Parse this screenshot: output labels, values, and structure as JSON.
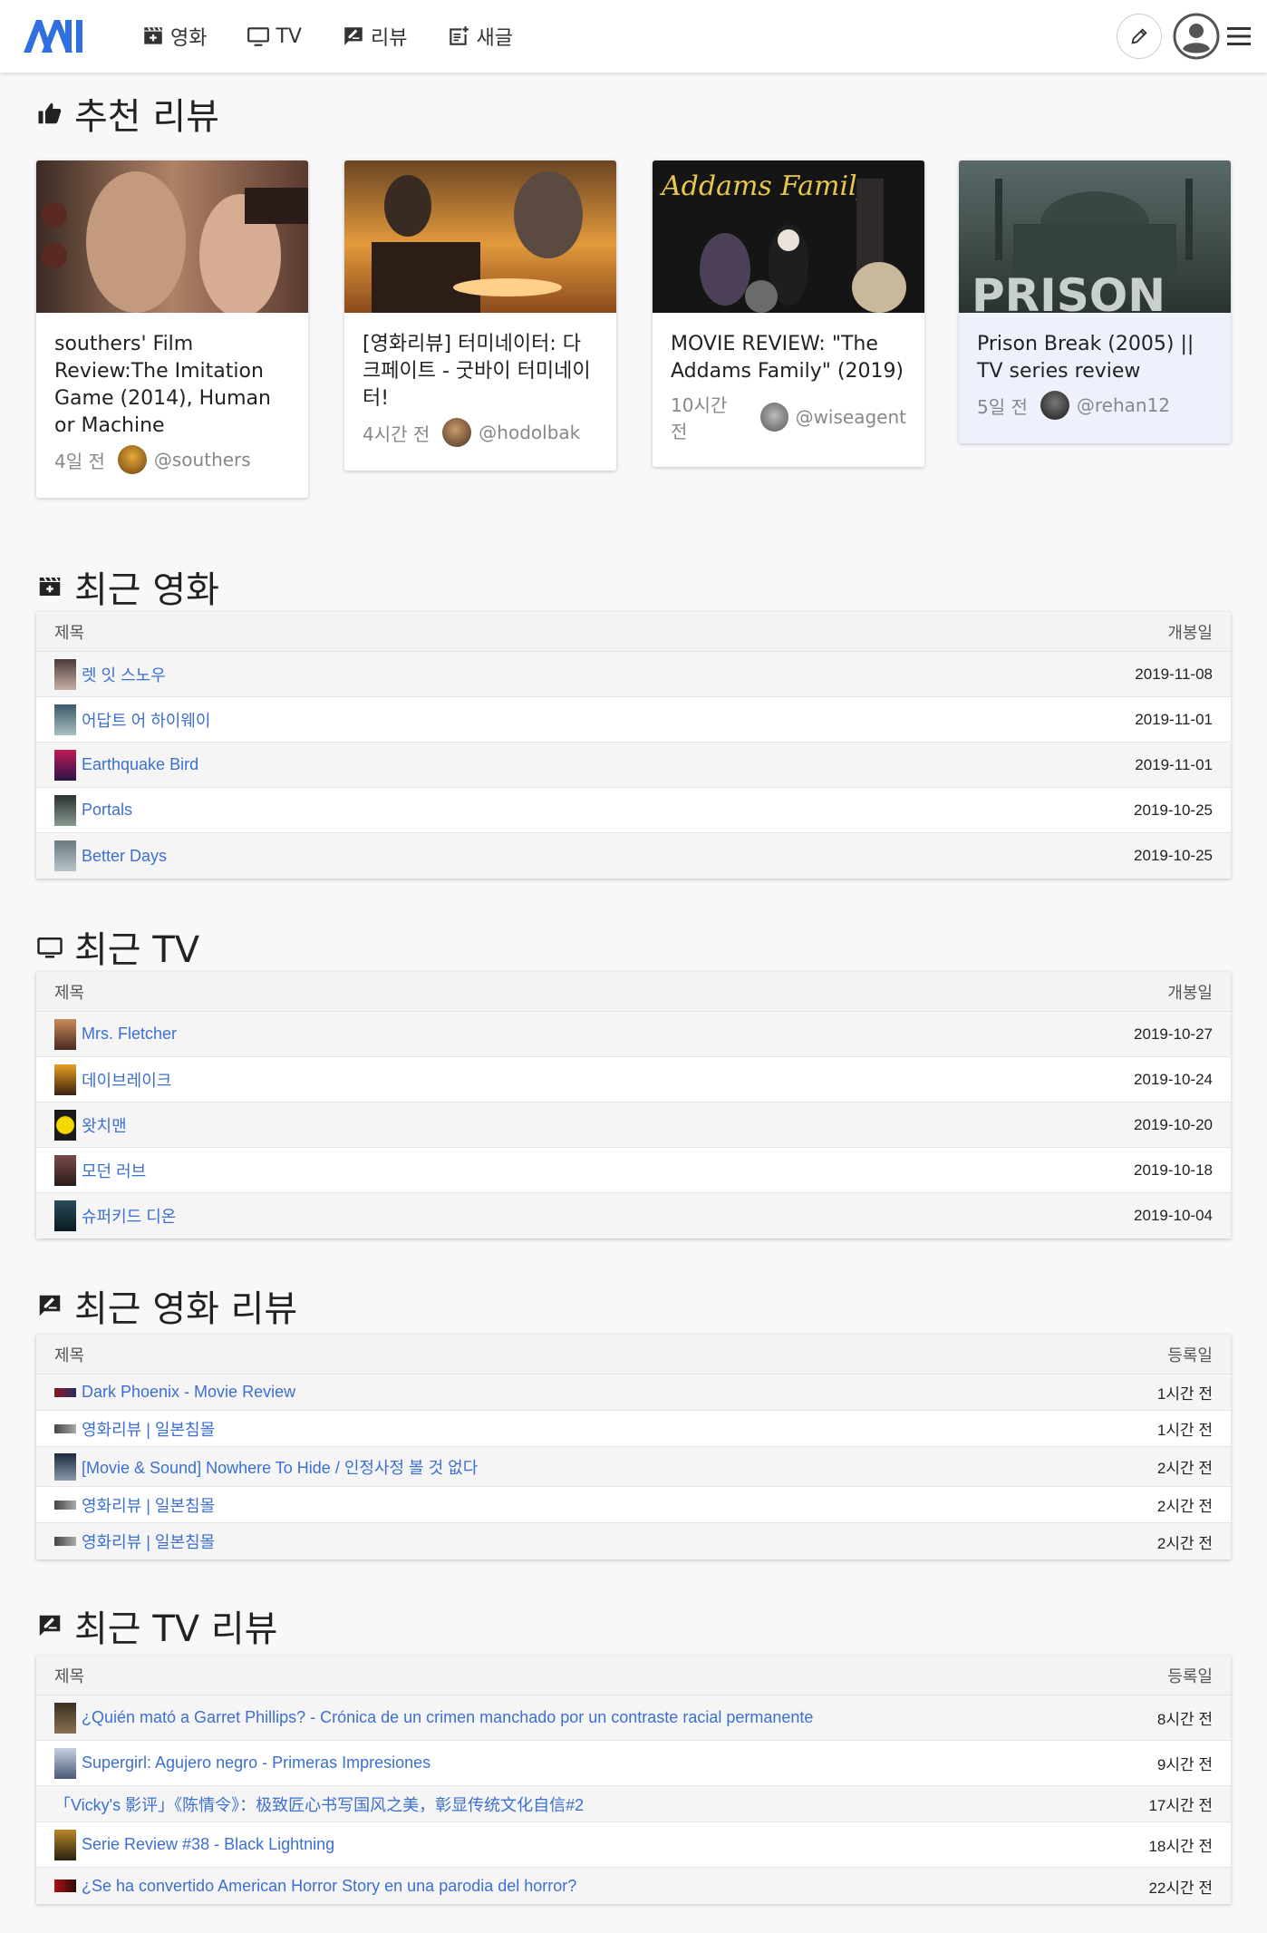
{
  "header": {
    "nav": [
      {
        "label": "영화",
        "icon": "movie-icon"
      },
      {
        "label": "TV",
        "icon": "tv-icon"
      },
      {
        "label": "리뷰",
        "icon": "review-icon"
      },
      {
        "label": "새글",
        "icon": "new-post-icon"
      }
    ]
  },
  "featured": {
    "title": "추천 리뷰",
    "cards": [
      {
        "title": "southers' Film Review:The Imitation Game (2014), Human or Machine",
        "time": "4일 전",
        "author": "@southers"
      },
      {
        "title": "[영화리뷰] 터미네이터: 다크페이트 - 굿바이 터미네이터!",
        "time": "4시간 전",
        "author": "@hodolbak"
      },
      {
        "title": "MOVIE REVIEW: \"The Addams Family\" (2019)",
        "time": "10시간 전",
        "author": "@wiseagent"
      },
      {
        "title": "Prison Break (2005) || TV series review",
        "time": "5일 전",
        "author": "@rehan12"
      }
    ]
  },
  "recent_movies": {
    "title": "최근 영화",
    "col_title": "제목",
    "col_date": "개봉일",
    "rows": [
      {
        "title": "렛 잇 스노우",
        "date": "2019-11-08"
      },
      {
        "title": "어답트 어 하이웨이",
        "date": "2019-11-01"
      },
      {
        "title": "Earthquake Bird",
        "date": "2019-11-01"
      },
      {
        "title": "Portals",
        "date": "2019-10-25"
      },
      {
        "title": "Better Days",
        "date": "2019-10-25"
      }
    ]
  },
  "recent_tv": {
    "title": "최근 TV",
    "col_title": "제목",
    "col_date": "개봉일",
    "rows": [
      {
        "title": "Mrs. Fletcher",
        "date": "2019-10-27"
      },
      {
        "title": "데이브레이크",
        "date": "2019-10-24"
      },
      {
        "title": "왓치맨",
        "date": "2019-10-20"
      },
      {
        "title": "모던 러브",
        "date": "2019-10-18"
      },
      {
        "title": "슈퍼키드 디온",
        "date": "2019-10-04"
      }
    ]
  },
  "recent_movie_reviews": {
    "title": "최근 영화 리뷰",
    "col_title": "제목",
    "col_date": "등록일",
    "rows": [
      {
        "title": "Dark Phoenix - Movie Review",
        "date": "1시간 전"
      },
      {
        "title": "영화리뷰 | 일본침몰",
        "date": "1시간 전"
      },
      {
        "title": "[Movie & Sound] Nowhere To Hide / 인정사정 볼 것 없다",
        "date": "2시간 전"
      },
      {
        "title": "영화리뷰 | 일본침몰",
        "date": "2시간 전"
      },
      {
        "title": "영화리뷰 | 일본침몰",
        "date": "2시간 전"
      }
    ]
  },
  "recent_tv_reviews": {
    "title": "최근 TV 리뷰",
    "col_title": "제목",
    "col_date": "등록일",
    "rows": [
      {
        "title": "¿Quién mató a Garret Phillips? - Crónica de un crimen manchado por un contraste racial permanente",
        "date": "8시간 전"
      },
      {
        "title": "Supergirl: Agujero negro - Primeras Impresiones",
        "date": "9시간 전"
      },
      {
        "title": "「Vicky's 影评」《陈情令》：极致匠心书写国风之美，彰显传统文化自信#2",
        "date": "17시간 전"
      },
      {
        "title": "Serie Review #38 - Black Lightning",
        "date": "18시간 전"
      },
      {
        "title": "¿Se ha convertido American Horror Story en una parodia del horror?",
        "date": "22시간 전"
      }
    ]
  }
}
